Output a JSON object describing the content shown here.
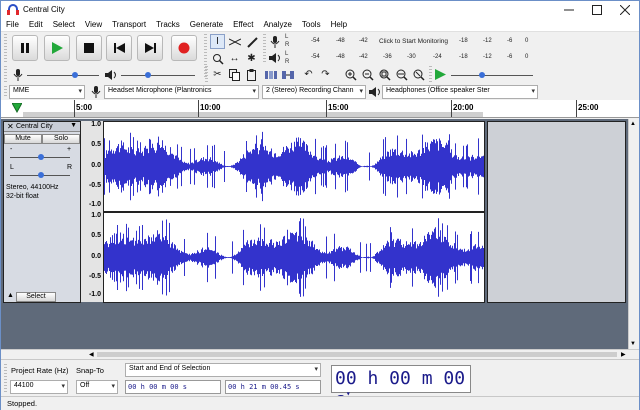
{
  "window": {
    "title": "Central City"
  },
  "menu": [
    "File",
    "Edit",
    "Select",
    "View",
    "Transport",
    "Tracks",
    "Generate",
    "Effect",
    "Analyze",
    "Tools",
    "Help"
  ],
  "meter": {
    "start_monitoring": "Click to Start Monitoring",
    "rec_scale": [
      "-54",
      "-48",
      "-42",
      "-18",
      "-12",
      "-6",
      "0"
    ],
    "play_scale": [
      "-54",
      "-48",
      "-42",
      "-36",
      "-30",
      "-24",
      "-18",
      "-12",
      "-6",
      "0"
    ]
  },
  "devices": {
    "host": "MME",
    "input": "Headset Microphone (Plantronics",
    "channels": "2 (Stereo) Recording Chann",
    "output": "Headphones (Office speaker Ster"
  },
  "ruler": {
    "labels": [
      "5:00",
      "10:00",
      "15:00",
      "20:00",
      "25:00"
    ]
  },
  "track": {
    "name": "Central City",
    "mute": "Mute",
    "solo": "Solo",
    "gain_minus": "-",
    "gain_plus": "+",
    "pan_left": "L",
    "pan_right": "R",
    "info_line1": "Stereo, 44100Hz",
    "info_line2": "32-bit float",
    "select": "Select",
    "scale": [
      "1.0",
      "0.5",
      "0.0",
      "-0.5",
      "-1.0"
    ]
  },
  "selection_toolbar": {
    "project_rate_label": "Project Rate (Hz)",
    "project_rate_value": "44100",
    "snap_to_label": "Snap-To",
    "snap_to_value": "Off",
    "selection_mode": "Start and End of Selection",
    "start_time": "00 h 00 m 00 s",
    "end_time": "00 h 21 m 00.45 s",
    "audio_position": "00 h 00 m 00 s"
  },
  "status": {
    "text": "Stopped."
  },
  "colors": {
    "waveform": "#3333cc",
    "track_bg": "#ffffff",
    "play_green": "#22a83a",
    "record_red": "#e02020"
  },
  "icons": [
    "pause-icon",
    "play-icon",
    "stop-icon",
    "skip-start-icon",
    "skip-end-icon",
    "record-icon",
    "ibeam-icon",
    "envelope-icon",
    "pencil-icon",
    "zoom-icon",
    "timeshift-icon",
    "multi-tool-icon",
    "microphone-icon",
    "speaker-icon",
    "cut-icon",
    "copy-icon",
    "paste-icon",
    "trim-icon",
    "silence-icon",
    "undo-icon",
    "redo-icon",
    "zoom-in-icon",
    "zoom-out-icon",
    "fit-selection-icon",
    "fit-project-icon",
    "zoom-toggle-icon"
  ]
}
